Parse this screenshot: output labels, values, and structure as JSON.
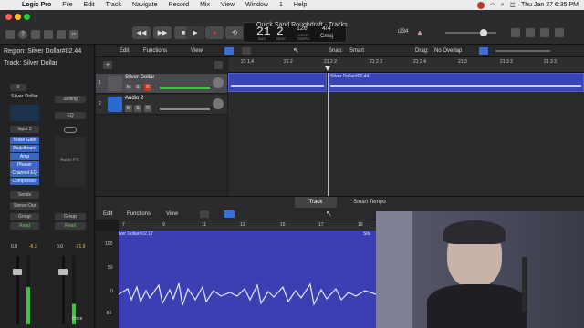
{
  "menubar": {
    "app": "Logic Pro",
    "items": [
      "File",
      "Edit",
      "Track",
      "Navigate",
      "Record",
      "Mix",
      "View",
      "Window",
      "1",
      "Help"
    ],
    "clock": "Thu Jan 27  6:35 PM"
  },
  "window": {
    "title": "Quick Sand Roughdraft - Tracks"
  },
  "lcd": {
    "bar": "21",
    "beat": "2",
    "bar_label": "BAR",
    "beat_label": "BEAT",
    "tempo": "120",
    "tempo_keep": "KEEP",
    "tempo_label": "TEMPO",
    "time_sig": "4/4",
    "key": "Cmaj",
    "cpu": "ι234"
  },
  "inspector": {
    "region_label": "Region: Silver Dollar#02.44",
    "track_label": "Track: Silver Dollar",
    "channel_name": "Silver Dollar",
    "setting": "Setting",
    "eq": "EQ",
    "input": "Input 2",
    "plugins": [
      "Noise Gate",
      "Pedalboard",
      "Amp",
      "Phaser",
      "Channel EQ",
      "Compressor"
    ],
    "audio_fx": "Audio FX",
    "sends": "Sends",
    "output": "Stereo Out",
    "group": "Group",
    "group2": "Group",
    "read": "Read",
    "read2": "Read",
    "vol1": "0.0",
    "peak1": "-6.3",
    "vol2": "0.0",
    "peak2": "-21.9",
    "bnce": "Bnce",
    "pan_value": "0"
  },
  "tracks_toolbar": {
    "edit": "Edit",
    "functions": "Functions",
    "view": "View",
    "snap_label": "Snap:",
    "snap_value": "Smart",
    "drag_label": "Drag:",
    "drag_value": "No Overlap"
  },
  "ruler": [
    "21 1.4",
    "21 2",
    "21 2 2",
    "21 2 3",
    "21 2 4",
    "21 3",
    "21 3 2",
    "21 3 3"
  ],
  "tracks": [
    {
      "num": "1",
      "name": "Silver Dollar"
    },
    {
      "num": "2",
      "name": "Audio 2"
    }
  ],
  "regions": {
    "region1": "Silver Dollar#02.44"
  },
  "tabs": {
    "track": "Track",
    "smart_tempo": "Smart Tempo"
  },
  "editor_toolbar": {
    "edit": "Edit",
    "functions": "Functions",
    "view": "View"
  },
  "editor_ruler": [
    "7",
    "9",
    "11",
    "13",
    "15",
    "17",
    "19"
  ],
  "editor_region": "lver Dollar#02.17",
  "editor_region2": "Silv",
  "editor_scale": [
    "100",
    "50",
    "0",
    "-50",
    "-100"
  ]
}
